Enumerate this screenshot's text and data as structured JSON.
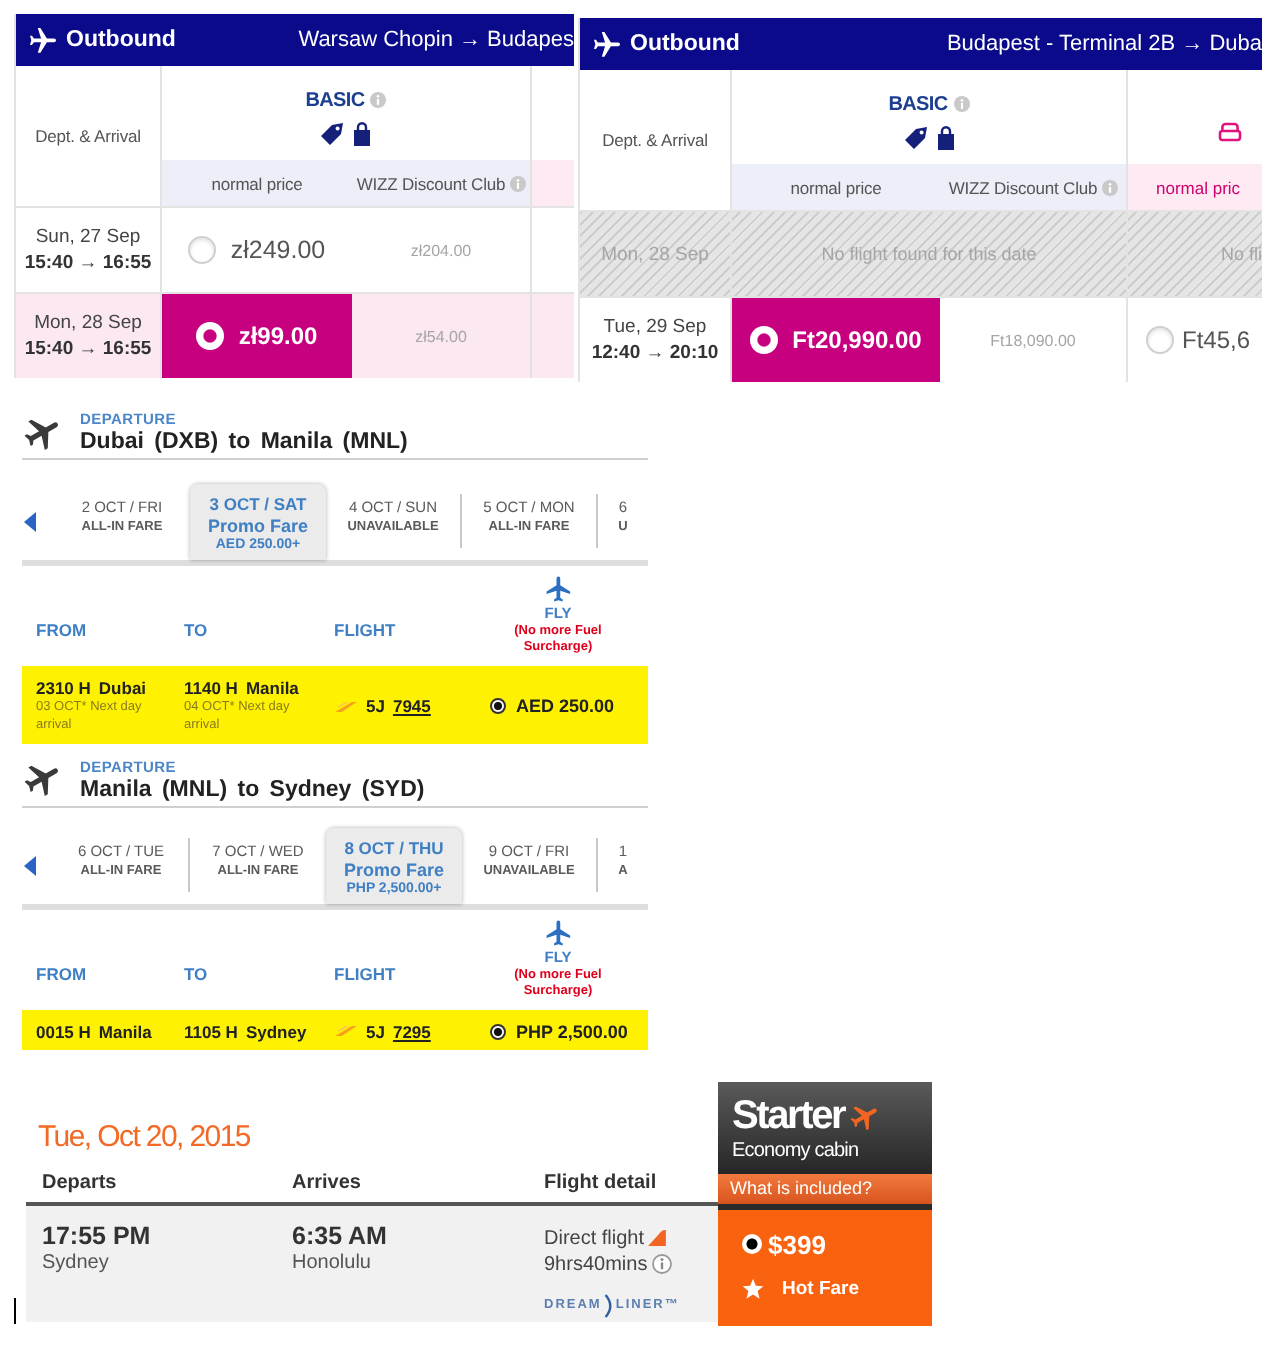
{
  "wizz_panels": [
    {
      "title": "Outbound",
      "route": "Warsaw Chopin → Budapes",
      "dept_label": "Dept. & Arrival",
      "fare_name": "BASIC",
      "subheaders": [
        "normal price",
        "WIZZ Discount Club"
      ],
      "rows": [
        {
          "kind": "flight",
          "highlighted": false,
          "date": "Sun, 27 Sep",
          "times": "15:40 → 16:55",
          "price": "zł249.00",
          "club_price": "zł204.00",
          "selected": false
        },
        {
          "kind": "flight",
          "highlighted": true,
          "date": "Mon, 28 Sep",
          "times": "15:40 → 16:55",
          "price": "zł99.00",
          "club_price": "zł54.00",
          "selected": true
        }
      ]
    },
    {
      "title": "Outbound",
      "route": "Budapest - Terminal 2B → Duba",
      "dept_label": "Dept. & Arrival",
      "fare_name": "BASIC",
      "subheaders": [
        "normal price",
        "WIZZ Discount Club"
      ],
      "next_subheader": "normal pric",
      "rows": [
        {
          "kind": "unavailable",
          "date": "Mon, 28 Sep",
          "message": "No flight found for this date",
          "next_message": "No fli"
        },
        {
          "kind": "flight",
          "highlighted": false,
          "date": "Tue, 29 Sep",
          "times": "12:40 → 20:10",
          "price": "Ft20,990.00",
          "club_price": "Ft18,090.00",
          "selected": true,
          "next_price": "Ft45,6",
          "next_selected": false
        }
      ]
    }
  ],
  "cebu_panels": [
    {
      "label": "DEPARTURE",
      "route": "Dubai (DXB) to Manila (MNL)",
      "dates": [
        {
          "date": "2 OCT / FRI",
          "status": "ALL-IN FARE",
          "selected": false
        },
        {
          "date": "3 OCT / SAT",
          "status": "Promo Fare",
          "price": "AED 250.00+",
          "selected": true
        },
        {
          "date": "4 OCT / SUN",
          "status": "UNAVAILABLE",
          "selected": false
        },
        {
          "date": "5 OCT / MON",
          "status": "ALL-IN FARE",
          "selected": false
        },
        {
          "date": "6",
          "status": "U",
          "selected": false
        }
      ],
      "columns": [
        "FROM",
        "TO",
        "FLIGHT"
      ],
      "fare_title": "FLY",
      "fare_note": "(No more Fuel Surcharge)",
      "flight": {
        "from_time": "2310 H",
        "from_city": "Dubai",
        "from_note": "03 OCT*  Next day arrival",
        "to_time": "1140 H",
        "to_city": "Manila",
        "to_note": "04 OCT*  Next day arrival",
        "carrier": "5J",
        "number": "7945",
        "price": "AED 250.00",
        "selected": true
      }
    },
    {
      "label": "DEPARTURE",
      "route": "Manila (MNL) to Sydney (SYD)",
      "dates": [
        {
          "date": "6 OCT / TUE",
          "status": "ALL-IN FARE",
          "selected": false
        },
        {
          "date": "7 OCT / WED",
          "status": "ALL-IN FARE",
          "selected": false
        },
        {
          "date": "8 OCT / THU",
          "status": "Promo Fare",
          "price": "PHP 2,500.00+",
          "selected": true
        },
        {
          "date": "9 OCT / FRI",
          "status": "UNAVAILABLE",
          "selected": false
        },
        {
          "date": "1",
          "status": "A",
          "selected": false
        }
      ],
      "columns": [
        "FROM",
        "TO",
        "FLIGHT"
      ],
      "fare_title": "FLY",
      "fare_note": "(No more Fuel Surcharge)",
      "flight": {
        "from_time": "0015 H",
        "from_city": "Manila",
        "to_time": "1105 H",
        "to_city": "Sydney",
        "carrier": "5J",
        "number": "7295",
        "price": "PHP 2,500.00",
        "selected": true
      }
    }
  ],
  "jetstar": {
    "date": "Tue, Oct 20, 2015",
    "columns": [
      "Departs",
      "Arrives",
      "Flight detail"
    ],
    "fare": {
      "name": "Starter",
      "cabin": "Economy cabin",
      "link": "What is included?",
      "price": "$399",
      "selected": true,
      "badge": "Hot Fare"
    },
    "flight": {
      "depart_time": "17:55 PM",
      "depart_city": "Sydney",
      "arrive_time": "6:35 AM",
      "arrive_city": "Honolulu",
      "stops": "Direct flight",
      "duration": "9hrs40mins",
      "logo_parts": [
        "DREAM",
        "LINER™"
      ]
    }
  }
}
